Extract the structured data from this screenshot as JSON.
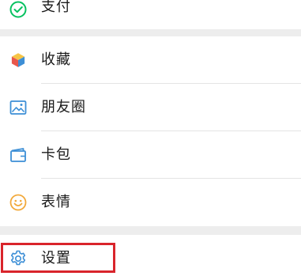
{
  "menu": {
    "pay": {
      "label": "支付",
      "icon": "wechat-pay-icon"
    },
    "favorites": {
      "label": "收藏",
      "icon": "favorites-cube-icon"
    },
    "moments": {
      "label": "朋友圈",
      "icon": "moments-picture-icon"
    },
    "cards": {
      "label": "卡包",
      "icon": "card-wallet-icon"
    },
    "stickers": {
      "label": "表情",
      "icon": "smiley-icon"
    },
    "settings": {
      "label": "设置",
      "icon": "gear-icon"
    }
  },
  "colors": {
    "background": "#ededed",
    "row": "#ffffff",
    "highlight": "#d9242b",
    "pay_green": "#07c160",
    "icon_blue": "#3d8fd6",
    "sticker_yellow": "#f2a93b"
  }
}
